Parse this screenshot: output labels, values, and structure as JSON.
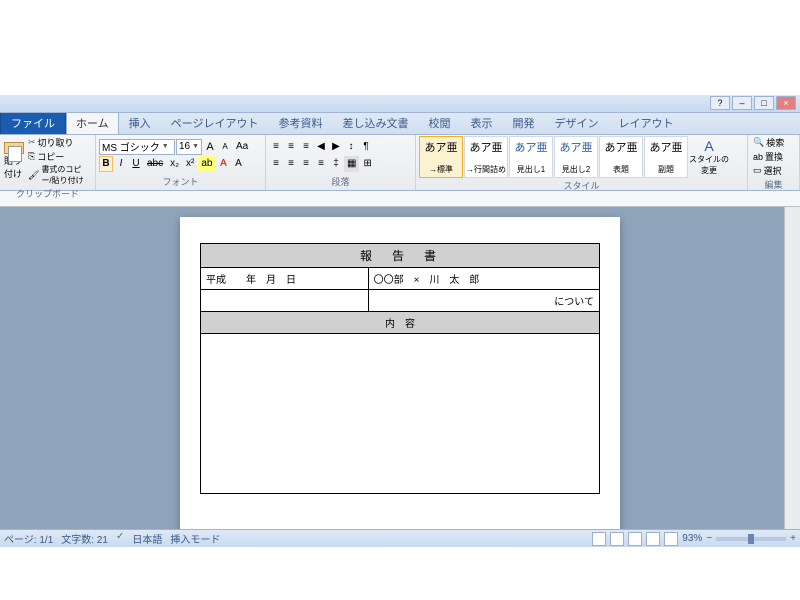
{
  "window": {
    "min": "‒",
    "max": "□",
    "close": "×",
    "help": "?"
  },
  "tabs": {
    "file": "ファイル",
    "items": [
      "ホーム",
      "挿入",
      "ページレイアウト",
      "参考資料",
      "差し込み文書",
      "校閲",
      "表示",
      "開発",
      "デザイン",
      "レイアウト"
    ],
    "active": 0
  },
  "clipboard": {
    "paste": "貼り付け",
    "cut": "切り取り",
    "copy": "コピー",
    "format": "書式のコピー/貼り付け",
    "label": "クリップボード"
  },
  "font": {
    "name": "MS ゴシック",
    "size": "16",
    "label": "フォント",
    "btns": [
      "B",
      "I",
      "U",
      "abc",
      "x₂",
      "x²"
    ],
    "grow": "A",
    "shrink": "A",
    "clear": "Aa"
  },
  "para": {
    "label": "段落"
  },
  "styles": {
    "label": "スタイル",
    "change": "スタイルの\n変更",
    "items": [
      {
        "prev": "あア亜",
        "name": "→標準",
        "sel": true
      },
      {
        "prev": "あア亜",
        "name": "→行間詰め"
      },
      {
        "prev": "あア亜",
        "name": "見出し1"
      },
      {
        "prev": "あア亜",
        "name": "見出し2"
      },
      {
        "prev": "あア亜",
        "name": "表題"
      },
      {
        "prev": "あア亜",
        "name": "副題"
      }
    ]
  },
  "edit": {
    "label": "編集",
    "find": "検索",
    "replace": "置換",
    "select": "選択"
  },
  "doc": {
    "title": "報　告　書",
    "date": "平成　　年　月　日",
    "dept": "〇〇部　×　川　太　郎",
    "about": "について",
    "contents": "内　容"
  },
  "status": {
    "page": "ページ: 1/1",
    "words": "文字数: 21",
    "lang": "日本語",
    "mode": "挿入モード",
    "zoom": "93%"
  }
}
